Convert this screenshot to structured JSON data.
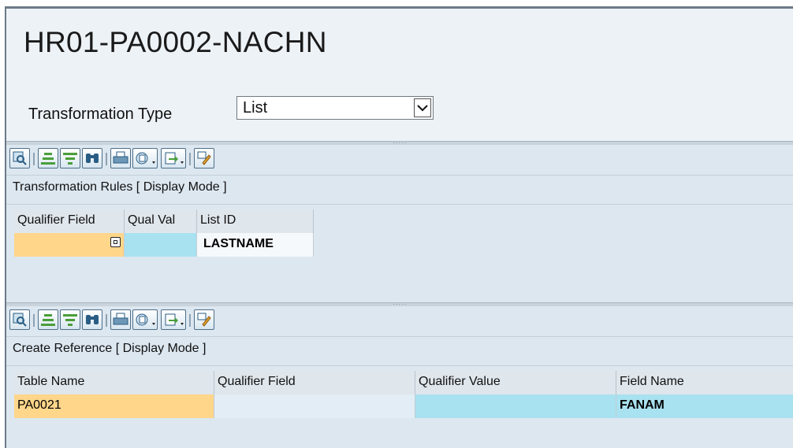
{
  "header": {
    "title": "HR01-PA0002-NACHN",
    "transformation_type_label": "Transformation Type",
    "transformation_type_value": "List"
  },
  "toolbar_icons": [
    "details-icon",
    "sort-ascending-icon",
    "filter-icon",
    "find-icon",
    "print-icon",
    "view-icon",
    "export-icon",
    "layout-icon"
  ],
  "rules_panel": {
    "title": "Transformation Rules [ Display Mode ]",
    "columns": [
      "Qualifier Field",
      "Qual Val",
      "List ID"
    ],
    "rows": [
      {
        "qualifier_field": "",
        "qual_val": "",
        "list_id": "LASTNAME"
      }
    ]
  },
  "reference_panel": {
    "title": "Create Reference [ Display Mode ]",
    "columns": [
      "Table Name",
      "Qualifier Field",
      "Qualifier Value",
      "Field Name"
    ],
    "rows": [
      {
        "table_name": "PA0021",
        "qualifier_field": "",
        "qualifier_value": "",
        "field_name": "FANAM"
      }
    ]
  },
  "colors": {
    "key_cell": "#ffd68a",
    "value_cell": "#a8e1f0",
    "panel_bg": "#dde7f0",
    "header_bg": "#edf2f7"
  }
}
